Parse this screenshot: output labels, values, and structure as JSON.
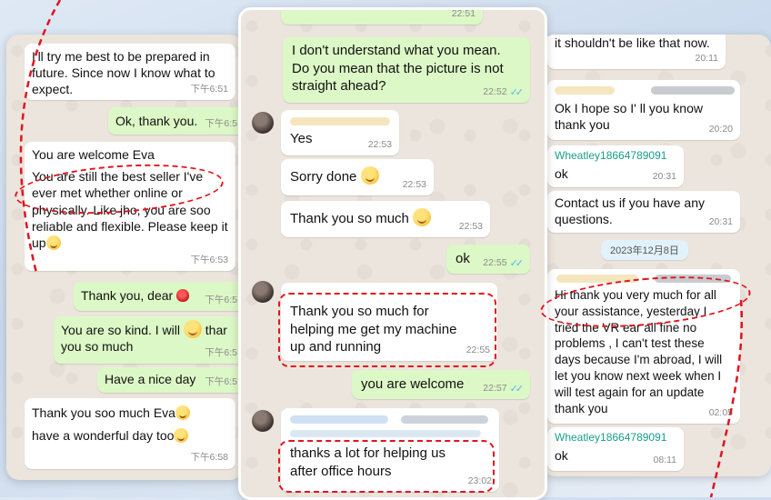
{
  "left_panel": {
    "messages": [
      {
        "text": "I'll try me best to be prepared in future. Since now I know what to expect.",
        "time": "下午6:51"
      },
      {
        "text": "Ok, thank you.",
        "time": "下午6:5"
      },
      {
        "text_a": "You are welcome Eva",
        "text_b": "You are still the best seller I've ever met whether online or physically.  Like jho, you are soo reliable and flexible.  Please keep it up",
        "time": "下午6:53"
      },
      {
        "text": "Thank you, dear",
        "time": "下午6:5"
      },
      {
        "text_a": "You are so kind. I will",
        "text_b": "thar",
        "text_c": "you so much",
        "time": "下午6:5"
      },
      {
        "text": "Have a nice day",
        "time": "下午6:5"
      },
      {
        "text_a": "Thank you soo much Eva",
        "text_b": "have a wonderful day too",
        "time": "下午6:58"
      }
    ]
  },
  "mid_panel": {
    "messages": [
      {
        "time": "22:51"
      },
      {
        "text": "I don't understand what you mean. Do you mean that the picture is not straight ahead?",
        "time": "22:52"
      },
      {
        "text": "Yes",
        "time": "22:53"
      },
      {
        "text": "Sorry done",
        "time": "22:53"
      },
      {
        "text": "Thank you so much",
        "time": "22:53"
      },
      {
        "text": "ok",
        "time": "22:55"
      },
      {
        "text": "Thank you so much for helping me get my machine up and running",
        "time": "22:55"
      },
      {
        "text": "you are welcome",
        "time": "22:57"
      },
      {
        "text": "thanks a lot for helping us after office hours",
        "time": "23:02"
      }
    ]
  },
  "right_panel": {
    "date_divider": "2023年12月8日",
    "messages": [
      {
        "text": "it shouldn't be like that now.",
        "time": "20:11"
      },
      {
        "text": "Ok I hope so I' ll you know thank you",
        "time": "20:20"
      },
      {
        "sender": "Wheatley18664789091",
        "text": "ok",
        "time": "20:31"
      },
      {
        "text": "Contact us if you have any questions.",
        "time": "20:31"
      },
      {
        "text": "Hi thank you very much for all your assistance, yesterday I tried the VR ear all fine no problems , I can't test these days because I'm abroad, I will let you know next week when I will test again for an update thank you",
        "time": "02:05"
      },
      {
        "sender": "Wheatley18664789091",
        "text": "ok",
        "time": "08:11"
      }
    ]
  },
  "colors": {
    "incoming": "#ffffff",
    "outgoing": "#dcf8c6",
    "highlight": "#e0141e",
    "sender": "#1a9c8a",
    "read_ticks": "#4fb6ec"
  }
}
